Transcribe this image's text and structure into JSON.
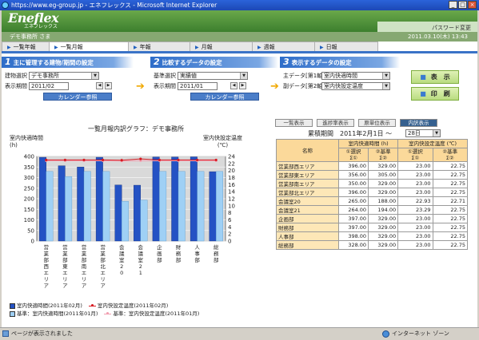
{
  "window": {
    "title": "https://www.eg-group.jp - エネフレックス - Microsoft Internet Explorer",
    "min": "_",
    "max": "□",
    "close": "×"
  },
  "header": {
    "logo": "Eneflex",
    "logo_sub": "エネフレックス",
    "password_change": "パスワード変更"
  },
  "userbar": {
    "user": "デモ事務所 さま",
    "datetime": "2011.03.10(木) 13:43"
  },
  "tabs": [
    {
      "label": "一覧年報"
    },
    {
      "label": "一覧月報"
    },
    {
      "label": "年報"
    },
    {
      "label": "月報"
    },
    {
      "label": "週報"
    },
    {
      "label": "日報"
    }
  ],
  "step1": {
    "title": "主に管理する建物/期間の設定",
    "num": "1",
    "building_label": "建物選択",
    "building_value": "デモ事務所",
    "period_label": "表示期間",
    "period_value": "2011/02",
    "calendar_btn": "カレンダー参照",
    "prev": "◀",
    "next": "▶"
  },
  "step2": {
    "title": "比較するデータの設定",
    "num": "2",
    "base_label": "基準選択",
    "base_value": "実績値",
    "period_label": "表示期間",
    "period_value": "2011/01",
    "calendar_btn": "カレンダー参照",
    "prev": "◀",
    "next": "▶"
  },
  "step3": {
    "title": "表示するデータの設定",
    "num": "3",
    "main_label": "主データ[第1軸]",
    "main_value": "室内快適時間",
    "sub_label": "副データ[第2軸]",
    "sub_value": "室内快設定温度"
  },
  "actions": {
    "display": "表　示",
    "print": "印　刷"
  },
  "view_tabs": [
    "一覧表示",
    "進捗率表示",
    "原単位表示",
    "内訳表示"
  ],
  "chart": {
    "title": "一覧月報内訳グラフ：デモ事務所",
    "left_axis_title": "室内快適時間",
    "left_axis_unit": "(h)",
    "right_axis_title": "室内快設定温度",
    "right_axis_unit": "(℃)",
    "legend": {
      "main": "室内快適時間(2011年02月)",
      "base": "基準：室内快適時間(2011年01月)",
      "temp_main": "室内快設定温度(2011年02月)",
      "temp_base": "基準：室内快設定温度(2011年01月)"
    }
  },
  "chart_data": {
    "type": "bar",
    "categories": [
      "営業部西エリア",
      "営業部東エリア",
      "営業部南エリア",
      "営業部北エリア",
      "会議室20",
      "会議室21",
      "企画部",
      "財務部",
      "人事部",
      "総務部"
    ],
    "series": [
      {
        "name": "室内快適時間(2011年02月)",
        "values": [
          396,
          356,
          350,
          396,
          265,
          264,
          397,
          397,
          398,
          328
        ]
      },
      {
        "name": "基準：室内快適時間(2011年01月)",
        "values": [
          329,
          305,
          329,
          329,
          188,
          194,
          329,
          329,
          329,
          329
        ]
      },
      {
        "name": "室内快設定温度(2011年02月)",
        "values": [
          23.0,
          23.0,
          23.0,
          23.0,
          22.93,
          23.29,
          23.0,
          23.0,
          23.0,
          23.0
        ]
      },
      {
        "name": "基準：室内快設定温度(2011年01月)",
        "values": [
          22.75,
          22.75,
          22.75,
          22.75,
          22.71,
          22.75,
          22.75,
          22.75,
          22.75,
          22.75
        ]
      }
    ],
    "ylim_left": [
      0,
      400
    ],
    "ylim_right": [
      0,
      24
    ],
    "left_ticks": [
      0,
      50,
      100,
      150,
      200,
      250,
      300,
      350,
      400
    ],
    "right_ticks": [
      0,
      2,
      4,
      6,
      8,
      10,
      12,
      14,
      16,
      18,
      20,
      22,
      24
    ],
    "colors": {
      "main": "#2452c4",
      "base": "#9fd0f5",
      "temp_main": "#d71920",
      "temp_base": "#f29fb0",
      "plot_bg": "#d9d9d9"
    }
  },
  "period": {
    "label": "累積期間",
    "from": "2011年2月1日 ～",
    "to": "28日"
  },
  "table": {
    "col_name": "名称",
    "group1": "室内快適時間 (h)",
    "group2": "室内快設定温度 (℃)",
    "sub1": "①選択",
    "sub1b": "Σ①",
    "sub2": "②基準",
    "sub2b": "Σ②",
    "rows": [
      [
        "営業部西エリア",
        "396.00",
        "329.00",
        "23.00",
        "22.75"
      ],
      [
        "営業部東エリア",
        "356.00",
        "305.00",
        "23.00",
        "22.75"
      ],
      [
        "営業部南エリア",
        "350.00",
        "329.00",
        "23.00",
        "22.75"
      ],
      [
        "営業部北エリア",
        "396.00",
        "329.00",
        "23.00",
        "22.75"
      ],
      [
        "会議室20",
        "265.00",
        "188.00",
        "22.93",
        "22.71"
      ],
      [
        "会議室21",
        "264.00",
        "194.00",
        "23.29",
        "22.75"
      ],
      [
        "企画部",
        "397.00",
        "329.00",
        "23.00",
        "22.75"
      ],
      [
        "財務部",
        "397.00",
        "329.00",
        "23.00",
        "22.75"
      ],
      [
        "人事部",
        "398.00",
        "329.00",
        "23.00",
        "22.75"
      ],
      [
        "総務部",
        "328.00",
        "329.00",
        "23.00",
        "22.75"
      ]
    ]
  },
  "statusbar": {
    "message": "ページが表示されました",
    "zone": "インターネット ゾーン"
  }
}
